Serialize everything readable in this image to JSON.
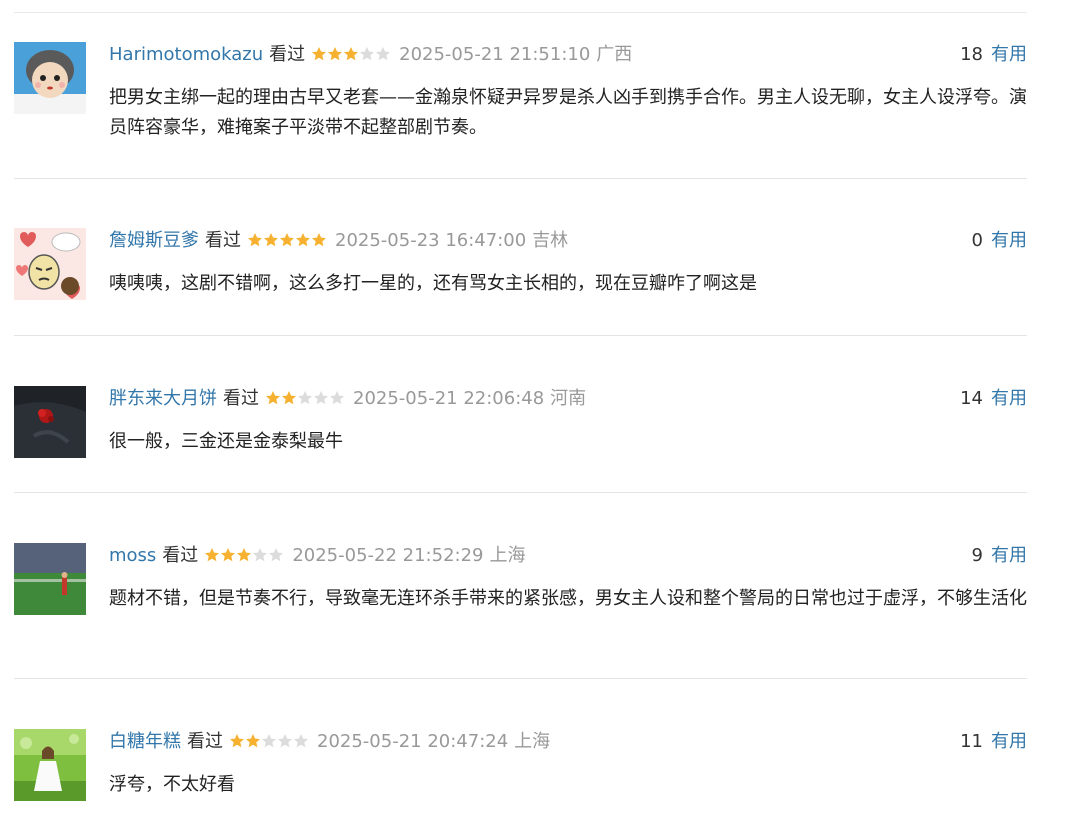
{
  "watched_label": "看过",
  "useful_label": "有用",
  "colors": {
    "link": "#3377aa",
    "star_on": "#f6b130",
    "star_off": "#dcdcdc",
    "muted": "#999999"
  },
  "comments": [
    {
      "user": "Harimotomokazu",
      "rating": 3,
      "time": "2025-05-21 21:51:10",
      "location": "广西",
      "votes": "18",
      "avatar_icon": "cartoon-boy-avatar",
      "text": "把男女主绑一起的理由古早又老套——金瀚泉怀疑尹异罗是杀人凶手到携手合作。男主人设无聊，女主人设浮夸。演员阵容豪华，难掩案子平淡带不起整部剧节奏。"
    },
    {
      "user": "詹姆斯豆爹",
      "rating": 5,
      "time": "2025-05-23 16:47:00",
      "location": "吉林",
      "votes": "0",
      "avatar_icon": "hearts-cartoon-avatar",
      "text": "咦咦咦，这剧不错啊，这么多打一星的，还有骂女主长相的，现在豆瓣咋了啊这是"
    },
    {
      "user": "胖东来大月饼",
      "rating": 2,
      "time": "2025-05-21 22:06:48",
      "location": "河南",
      "votes": "14",
      "avatar_icon": "dark-rose-avatar",
      "text": "很一般，三金还是金泰梨最牛"
    },
    {
      "user": "moss",
      "rating": 3,
      "time": "2025-05-22 21:52:29",
      "location": "上海",
      "votes": "9",
      "avatar_icon": "stadium-photo-avatar",
      "text": "题材不错，但是节奏不行，导致毫无连环杀手带来的紧张感，男女主人设和整个警局的日常也过于虚浮，不够生活化"
    },
    {
      "user": "白糖年糕",
      "rating": 2,
      "time": "2025-05-21 20:47:24",
      "location": "上海",
      "votes": "11",
      "avatar_icon": "girl-in-field-avatar",
      "text": "浮夸，不太好看"
    }
  ]
}
